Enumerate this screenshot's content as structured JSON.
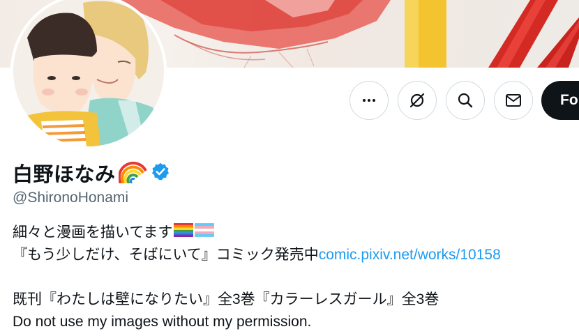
{
  "profile": {
    "display_name": "白野ほなみ",
    "name_emoji": "rainbow-emoji",
    "verified": true,
    "handle": "@ShironoHonami"
  },
  "actions": {
    "more": "more-icon",
    "subscribe": "grok-icon",
    "search": "search-icon",
    "message": "mail-icon",
    "follow_label": "Follow"
  },
  "bio": {
    "line1": "細々と漫画を描いてます",
    "line1_flags": [
      "rainbow-flag",
      "transgender-flag"
    ],
    "line2_text": "『もう少しだけ、そばにいて』コミック発売中",
    "line2_link": "comic.pixiv.net/works/10158",
    "line3": "既刊『わたしは壁になりたい』全3巻『カラーレスガール』全3巻",
    "line4": "Do not use my images without my permission."
  },
  "colors": {
    "link": "#1d9bf0",
    "verified": "#1d9bf0",
    "follow_bg": "#0f1419",
    "muted_text": "#536471"
  }
}
